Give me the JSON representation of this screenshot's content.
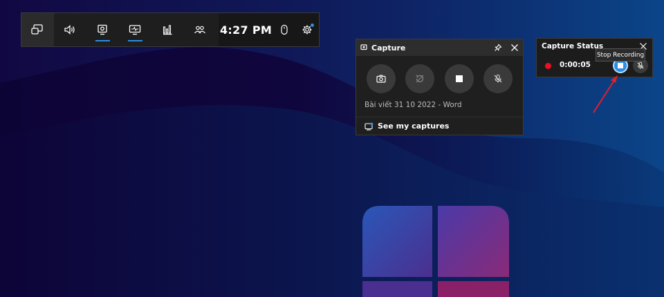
{
  "gamebar": {
    "clock": "4:27 PM",
    "buttons": [
      {
        "icon": "widget-menu-icon",
        "active": false
      },
      {
        "icon": "audio-icon",
        "active": false
      },
      {
        "icon": "capture-icon",
        "active": true
      },
      {
        "icon": "performance-icon",
        "active": true
      },
      {
        "icon": "resources-icon",
        "active": false
      },
      {
        "icon": "social-icon",
        "active": false
      }
    ]
  },
  "capture": {
    "title": "Capture",
    "source": "Bài viết 31 10 2022 - Word",
    "see_captures": "See my captures"
  },
  "status": {
    "title": "Capture Status",
    "timer": "0:00:05",
    "tooltip": "Stop Recording"
  },
  "colors": {
    "accent": "#2b8ee6",
    "record": "#e81123",
    "arrow": "#e0202a"
  }
}
